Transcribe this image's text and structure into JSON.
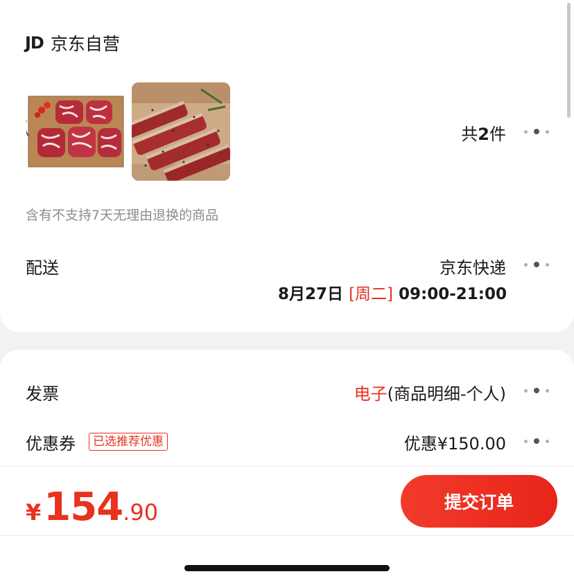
{
  "shop": {
    "logo_text": "JD",
    "name": "京东自营"
  },
  "items": {
    "count_prefix": "共",
    "count": "2",
    "count_suffix": "件",
    "return_notice": "含有不支持7天无理由退换的商品"
  },
  "delivery": {
    "label": "配送",
    "carrier": "京东快递",
    "date": "8月27日",
    "weekday": "[周二]",
    "time": "09:00-21:00"
  },
  "invoice": {
    "label": "发票",
    "type_highlight": "电子",
    "type_detail": "(商品明细-个人)"
  },
  "coupon": {
    "label": "优惠券",
    "tag": "已选推荐优惠",
    "value": "优惠¥150.00"
  },
  "checkout": {
    "currency": "¥",
    "price_int": "154",
    "price_dec": ".90",
    "submit_label": "提交订单"
  },
  "colors": {
    "accent": "#e8321e",
    "background": "#f2f2f2"
  }
}
